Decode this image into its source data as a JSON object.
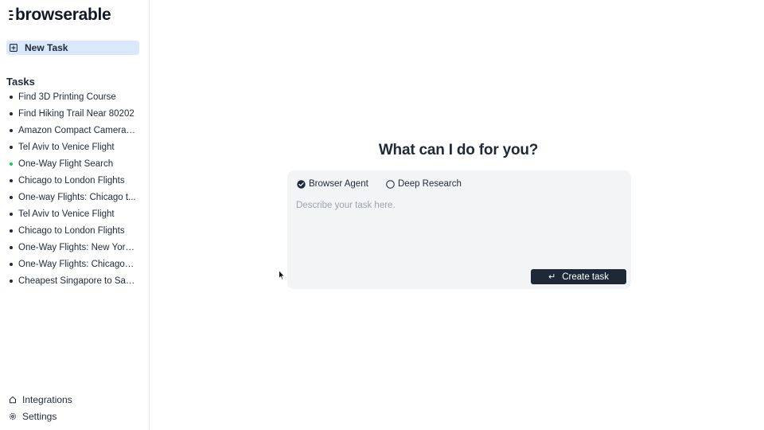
{
  "brand": {
    "name": "browserable"
  },
  "sidebar": {
    "new_task_label": "New Task",
    "tasks_heading": "Tasks",
    "tasks": [
      {
        "label": "Find 3D Printing Course",
        "status": "done"
      },
      {
        "label": "Find Hiking Trail Near 80202",
        "status": "done"
      },
      {
        "label": "Amazon Compact Camera ...",
        "status": "done"
      },
      {
        "label": "Tel Aviv to Venice Flight",
        "status": "done"
      },
      {
        "label": "One-Way Flight Search",
        "status": "active"
      },
      {
        "label": "Chicago to London Flights",
        "status": "done"
      },
      {
        "label": "One-way Flights: Chicago t...",
        "status": "done"
      },
      {
        "label": "Tel Aviv to Venice Flight",
        "status": "done"
      },
      {
        "label": "Chicago to London Flights",
        "status": "done"
      },
      {
        "label": "One-Way Flights: New York ...",
        "status": "done"
      },
      {
        "label": "One-Way Flights: Chicago t...",
        "status": "done"
      },
      {
        "label": "Cheapest Singapore to San ...",
        "status": "done"
      }
    ],
    "integrations_label": "Integrations",
    "settings_label": "Settings"
  },
  "main": {
    "title": "What can I do for you?",
    "modes": [
      {
        "label": "Browser Agent",
        "selected": true
      },
      {
        "label": "Deep Research",
        "selected": false
      }
    ],
    "input": {
      "placeholder": "Describe your task here.",
      "value": ""
    },
    "create_button": {
      "icon": "↵",
      "label": "Create task"
    }
  },
  "colors": {
    "new_task_bg": "#dbe7fb",
    "active_dot": "#22c55e",
    "button_bg": "#1e2837",
    "composer_bg": "#f3f4f6"
  },
  "icons": {
    "new_task": "plus-square-icon",
    "integrations": "plug-icon",
    "settings": "gear-icon",
    "mode_selected": "check-circle-icon",
    "mode_unselected": "circle-icon",
    "create": "enter-icon"
  }
}
